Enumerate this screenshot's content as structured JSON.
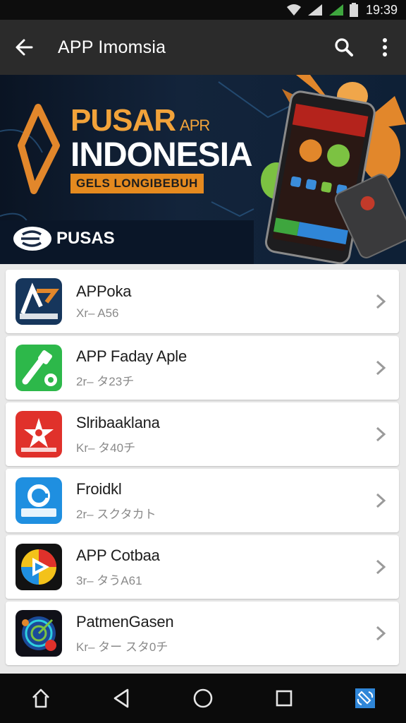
{
  "status_bar": {
    "time": "19:39"
  },
  "app_bar": {
    "title": "APP Imomsia"
  },
  "banner": {
    "line1": "PUSAR",
    "line1_small": "APR",
    "line2": "INDONESIA",
    "tagline": "GELS LONGIBEBUH",
    "brand": "PUSAS"
  },
  "apps": [
    {
      "name": "APPoka",
      "meta": "Xr– A56",
      "icon": "appoka-icon"
    },
    {
      "name": "APP Faday Aple",
      "meta": "2r– タ23チ",
      "icon": "faday-icon"
    },
    {
      "name": "Slribaaklana",
      "meta": "Kr– タ40チ",
      "icon": "star-icon"
    },
    {
      "name": "Froidkl",
      "meta": "2r– スクタカト",
      "icon": "froidkl-icon"
    },
    {
      "name": "APP Cotbaa",
      "meta": "3r– タうA61",
      "icon": "play-icon"
    },
    {
      "name": "PatmenGasen",
      "meta": "Kr– ター スタ0チ",
      "icon": "game-icon"
    }
  ],
  "colors": {
    "accent": "#f2a33a",
    "app_bar": "#2b2b2b",
    "list_bg": "#e9e9e9"
  }
}
